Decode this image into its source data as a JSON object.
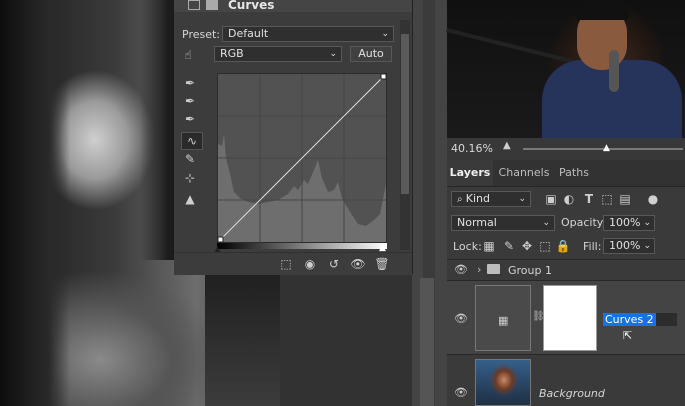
{
  "properties": {
    "title": "Curves",
    "preset_label": "Preset:",
    "preset_value": "Default",
    "channel_value": "RGB",
    "auto_button": "Auto"
  },
  "status": {
    "zoom": "40.16%"
  },
  "layers_panel": {
    "tabs": [
      "Layers",
      "Channels",
      "Paths"
    ],
    "filter_kind": "Kind",
    "blend_mode": "Normal",
    "opacity_label": "Opacity:",
    "opacity_value": "100%",
    "lock_label": "Lock:",
    "fill_label": "Fill:",
    "fill_value": "100%",
    "layers": [
      {
        "name": "Group 1"
      },
      {
        "name": "Curves 2"
      },
      {
        "name": "Background"
      }
    ]
  },
  "icons": {
    "layer_filter_icons": [
      "image-filter-icon",
      "adjustment-filter-icon",
      "type-filter-icon",
      "shape-filter-icon",
      "smart-object-filter-icon",
      "filter-toggle-icon"
    ],
    "lock_icons": [
      "lock-transparent-icon",
      "lock-paint-icon",
      "lock-move-icon",
      "lock-artboard-icon",
      "lock-all-icon"
    ],
    "curve_tools": [
      "target-adjust-icon",
      "black-point-eyedropper-icon",
      "gray-point-eyedropper-icon",
      "white-point-eyedropper-icon",
      "curve-point-icon",
      "pencil-icon",
      "smooth-icon",
      "clipping-warning-icon"
    ],
    "footer_icons": [
      "clip-to-layer-icon",
      "view-previous-icon",
      "reset-icon",
      "visibility-icon",
      "delete-icon"
    ]
  },
  "colors": {
    "selection": "#1473e6",
    "panel_bg": "#3a3a3a"
  }
}
